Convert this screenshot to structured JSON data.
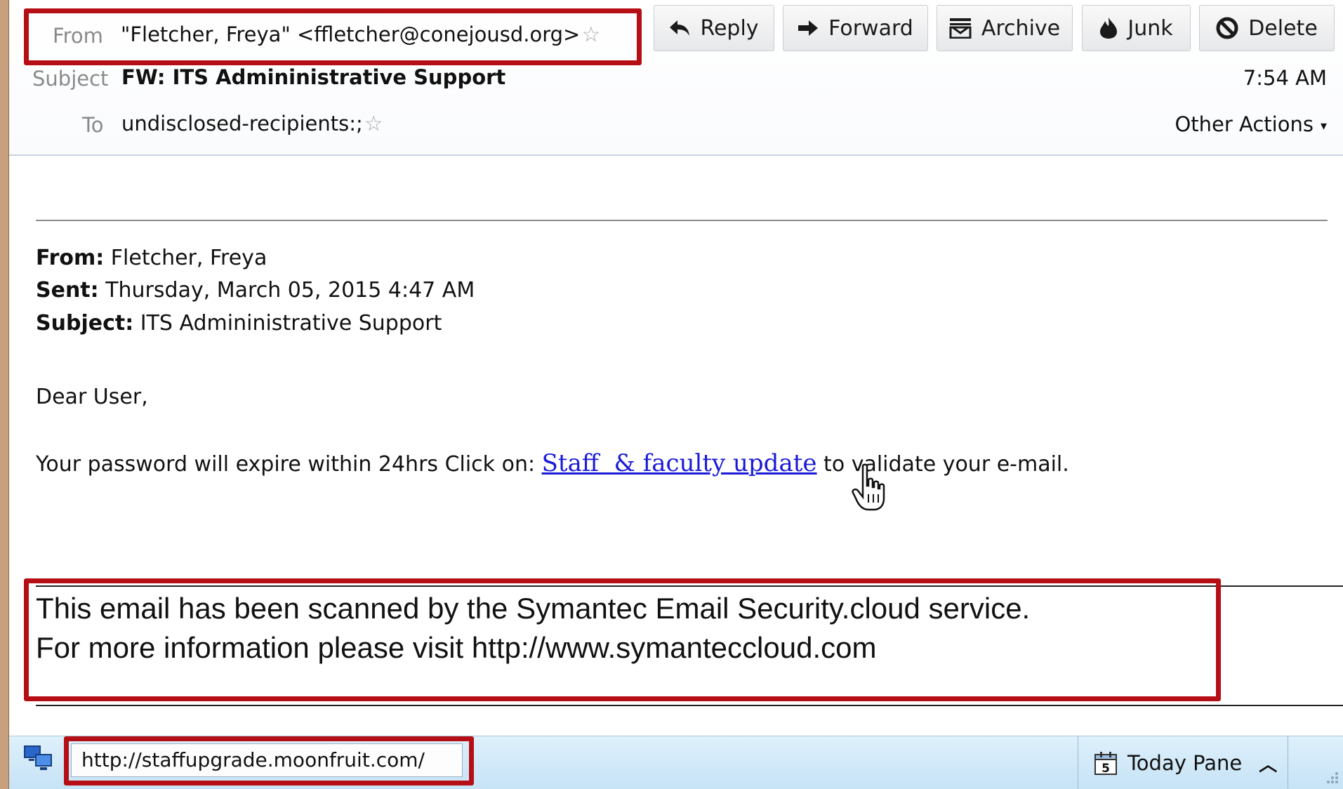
{
  "header": {
    "from_label": "From",
    "from_value": "\"Fletcher, Freya\" <ffletcher@conejousd.org>",
    "subject_label": "Subject",
    "subject_value": "FW: ITS Admininistrative Support",
    "to_label": "To",
    "to_value": "undisclosed-recipients:;",
    "time": "7:54 AM",
    "other_actions": "Other Actions"
  },
  "toolbar": {
    "reply": "Reply",
    "forward": "Forward",
    "archive": "Archive",
    "junk": "Junk",
    "delete": "Delete"
  },
  "body": {
    "fwd_from_label": "From:",
    "fwd_from_value": "Fletcher, Freya",
    "fwd_sent_label": "Sent:",
    "fwd_sent_value": "Thursday, March 05, 2015 4:47 AM",
    "fwd_subject_label": "Subject:",
    "fwd_subject_value": "ITS Admininistrative Support",
    "greeting": "Dear User,",
    "line_before": "Your password will expire within 24hrs Click on: ",
    "link_text": "Staff  & faculty update",
    "line_after": " to validate your e-mail.",
    "scan_line1": "This email has been scanned by the Symantec Email Security.cloud service.",
    "scan_line2": "For more information please visit http://www.symanteccloud.com"
  },
  "statusbar": {
    "url": "http://staffupgrade.moonfruit.com/",
    "today_pane": "Today Pane",
    "calendar_day": "5"
  },
  "colors": {
    "annotation_red": "#b60e15",
    "link_blue": "#1a1ad8",
    "statusbar_blue": "#d3eaf8"
  },
  "icons": [
    "reply-icon",
    "forward-icon",
    "archive-icon",
    "junk-icon",
    "delete-icon",
    "star-icon",
    "network-icon",
    "calendar-icon",
    "chevron-up-icon",
    "hand-cursor-icon"
  ]
}
